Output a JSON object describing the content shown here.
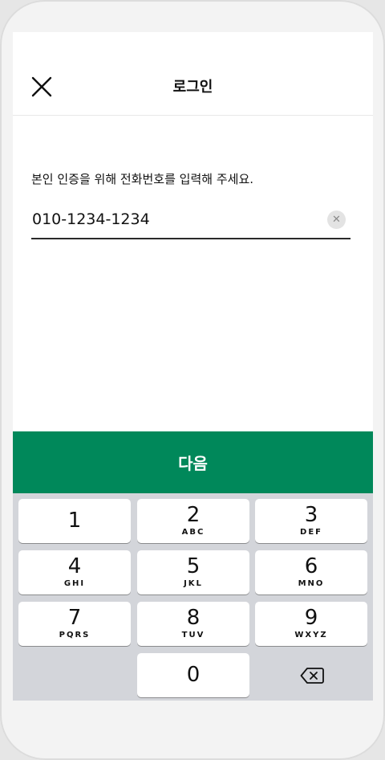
{
  "header": {
    "title": "로그인"
  },
  "form": {
    "prompt": "본인 인증을 위해 전화번호를 입력해 주세요.",
    "phone_value": "010-1234-1234"
  },
  "next_label": "다음",
  "keypad": {
    "keys": [
      {
        "digit": "1",
        "letters": ""
      },
      {
        "digit": "2",
        "letters": "ABC"
      },
      {
        "digit": "3",
        "letters": "DEF"
      },
      {
        "digit": "4",
        "letters": "GHI"
      },
      {
        "digit": "5",
        "letters": "JKL"
      },
      {
        "digit": "6",
        "letters": "MNO"
      },
      {
        "digit": "7",
        "letters": "PQRS"
      },
      {
        "digit": "8",
        "letters": "TUV"
      },
      {
        "digit": "9",
        "letters": "WXYZ"
      },
      {
        "digit": "0",
        "letters": ""
      }
    ]
  },
  "colors": {
    "accent": "#00885a",
    "keypad_bg": "#d3d5da"
  },
  "icons": {
    "close": "close-icon",
    "clear": "clear-icon",
    "backspace": "backspace-icon"
  }
}
